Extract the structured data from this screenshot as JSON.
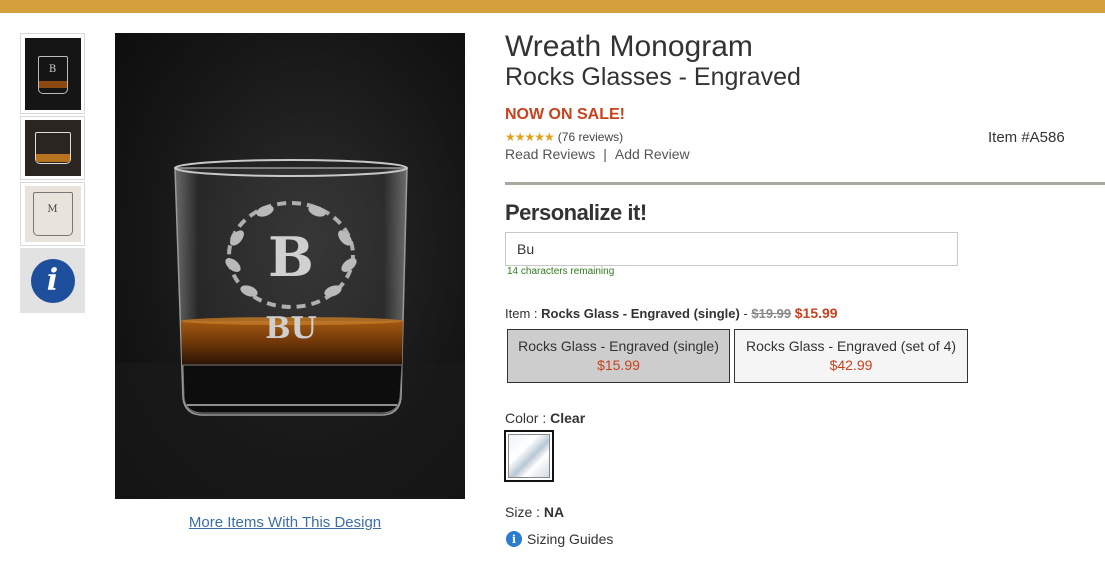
{
  "product": {
    "title_line1": "Wreath Monogram",
    "title_line2": "Rocks Glasses - Engraved",
    "sale_badge": "NOW ON SALE!",
    "stars": "★★★★★",
    "reviews_count": "(76 reviews)",
    "rating": 5,
    "read_reviews": "Read Reviews",
    "separator": "|",
    "add_review": "Add Review",
    "item_number": "Item #A586",
    "monogram_letter": "B",
    "monogram_text": "BU"
  },
  "gallery": {
    "thumbnails": [
      {
        "icon": "glass-thumbnail",
        "monogram": "B"
      },
      {
        "icon": "glass-packaging-thumbnail",
        "monogram": ""
      },
      {
        "icon": "glass-lifestyle-thumbnail",
        "monogram": "M"
      }
    ],
    "info_icon": "info-icon",
    "info_glyph": "i",
    "more_items_link": "More Items With This Design"
  },
  "personalize": {
    "heading": "Personalize it!",
    "input_value": "Bu",
    "remaining_text": "14 characters remaining"
  },
  "item_option": {
    "label": "Item : ",
    "selected_name": "Rocks Glass - Engraved (single)",
    "dash": " - ",
    "original_price": "$19.99",
    "sale_price": "$15.99",
    "options": [
      {
        "name": "Rocks Glass - Engraved (single)",
        "price": "$15.99",
        "selected": true
      },
      {
        "name": "Rocks Glass - Engraved (set of 4)",
        "price": "$42.99",
        "selected": false
      }
    ]
  },
  "color_option": {
    "label": "Color : ",
    "value": "Clear"
  },
  "size_option": {
    "label": "Size : ",
    "value": "NA",
    "sizing_guides": "Sizing Guides",
    "sizing_icon_glyph": "i"
  },
  "colors": {
    "top_bar": "#d4a03c",
    "sale_red": "#c8421c",
    "link_blue": "#3c6ea6",
    "info_blue": "#1d4f9c",
    "remaining_green": "#2e7d1a",
    "star_gold": "#e0a21d"
  }
}
